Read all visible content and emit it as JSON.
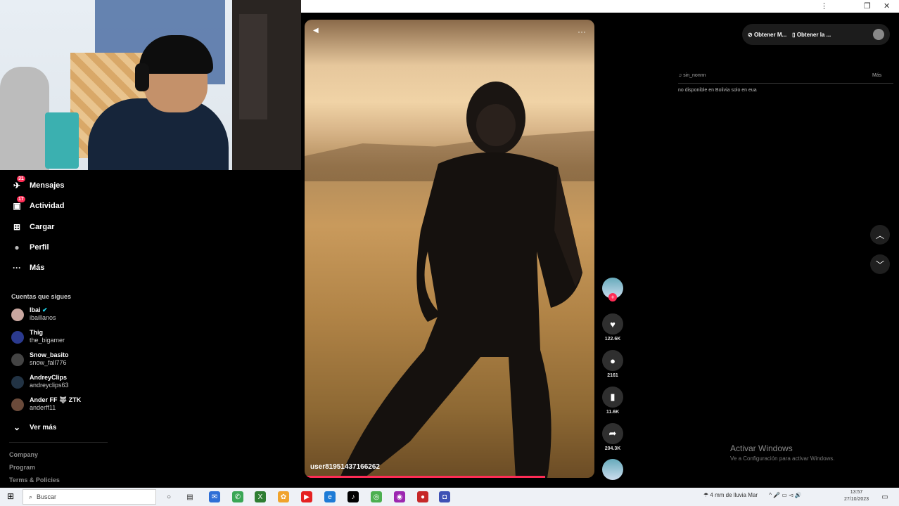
{
  "window": {
    "menu_icon": "⋮",
    "restore_icon": "❐",
    "close_icon": "✕"
  },
  "sidebar": {
    "nav": [
      {
        "label": "Mensajes",
        "icon": "send-icon",
        "glyph": "✈",
        "badge": "31"
      },
      {
        "label": "Actividad",
        "icon": "activity-icon",
        "glyph": "▣",
        "badge": "17"
      },
      {
        "label": "Cargar",
        "icon": "upload-icon",
        "glyph": "⊞",
        "badge": ""
      },
      {
        "label": "Perfil",
        "icon": "avatar-icon",
        "glyph": "●",
        "badge": ""
      },
      {
        "label": "Más",
        "icon": "more-icon",
        "glyph": "···",
        "badge": ""
      }
    ],
    "following_title": "Cuentas que sigues",
    "accounts": [
      {
        "name": "Ibai",
        "handle": "ibaillanos",
        "color": "#c9a7a0",
        "verified": true
      },
      {
        "name": "Thig",
        "handle": "the_bigamer",
        "color": "#2b3a8f",
        "verified": false
      },
      {
        "name": "Snow_basito",
        "handle": "snow_fall776",
        "color": "#444",
        "verified": false
      },
      {
        "name": "AndreyClips",
        "handle": "andreyclips63",
        "color": "#234",
        "verified": false
      },
      {
        "name": "Ander FF 🐺 ZTK",
        "handle": "anderff11",
        "color": "#6a4a3a",
        "verified": false
      }
    ],
    "see_more": "Ver más",
    "footer": [
      "Company",
      "Program",
      "Terms & Policies"
    ]
  },
  "video": {
    "username": "user81951437166262",
    "more_icon": "···",
    "progress": 0.83
  },
  "actions": {
    "likes": "122.6K",
    "comments": "2161",
    "saves": "11.6K",
    "shares": "204.3K"
  },
  "right_panel": {
    "get_app": "Obtener M...",
    "get_desktop": "Obtener la ...",
    "line1": "♫ sin_nonnn",
    "more": "Más",
    "line2": "no disponible en Bolivia solo en eua"
  },
  "watermark": {
    "title": "Activar Windows",
    "subtitle": "Ve a Configuración para activar Windows."
  },
  "taskbar": {
    "search_placeholder": "Buscar",
    "weather": "4 mm de lluvia Mar",
    "time": "13:57",
    "date": "27/10/2023"
  }
}
